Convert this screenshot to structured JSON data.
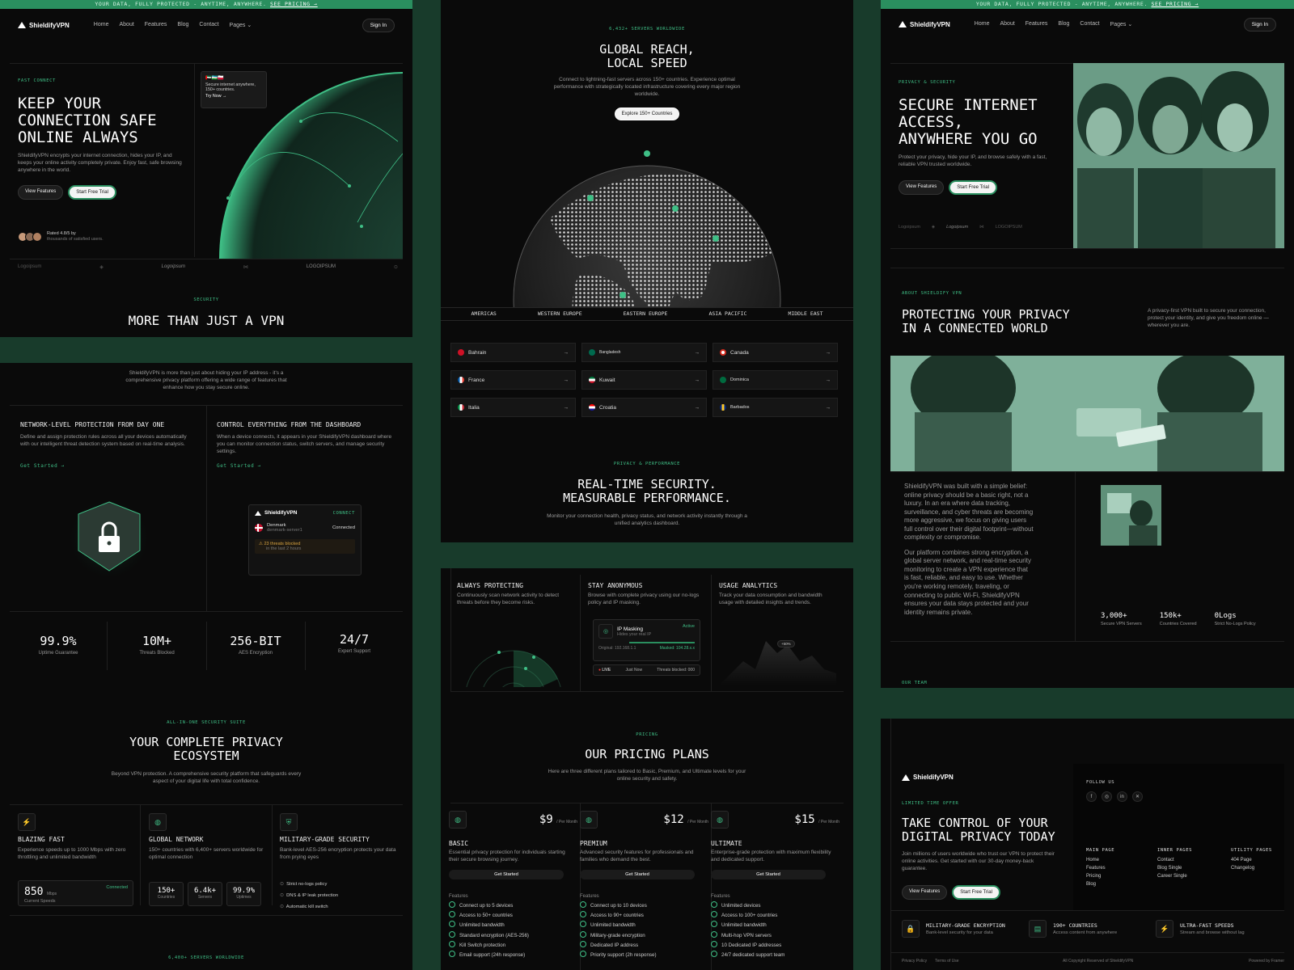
{
  "banner": {
    "text": "YOUR DATA, FULLY PROTECTED - ANYTIME, ANYWHERE.",
    "link": "SEE PRICING →"
  },
  "nav": {
    "logo": "ShieldifyVPN",
    "links": [
      "Home",
      "About",
      "Features",
      "Blog",
      "Contact",
      "Pages ⌄"
    ],
    "signin": "Sign In"
  },
  "hero": {
    "tag": "FAST CONNECT",
    "title_lines": [
      "KEEP YOUR",
      "CONNECTION SAFE",
      "ONLINE ALWAYS"
    ],
    "desc": "ShieldifyVPN encrypts your internet connection, hides your IP, and keeps your online activity completely private. Enjoy fast, safe browsing anywhere in the world.",
    "btn_features": "View Features",
    "btn_trial": "Start Free Trial",
    "popup_text": "Secure internet anywhere, 150+ countries.",
    "popup_link": "Try Now →",
    "rating_title": "Rated 4.8/5 by",
    "rating_sub": "thousands of satisfied users.",
    "logos": [
      "Logoipsum",
      "◈",
      "Logoipsum",
      "⋈",
      "LOGOIPSUM",
      "⊙"
    ]
  },
  "vpn_section": {
    "tag": "SECURITY",
    "title": "MORE THAN JUST A VPN",
    "desc": "ShieldifyVPN is more than just about hiding your IP address - it's a comprehensive privacy platform offering a wide range of features that enhance how you stay secure online."
  },
  "features2": [
    {
      "title": "NETWORK-LEVEL PROTECTION FROM DAY ONE",
      "desc": "Define and assign protection rules across all your devices automatically with our intelligent threat detection system based on real-time analysis.",
      "link": "Get Started →"
    },
    {
      "title": "CONTROL EVERYTHING FROM THE DASHBOARD",
      "desc": "When a device connects, it appears in your ShieldifyVPN dashboard where you can monitor connection status, switch servers, and manage security settings.",
      "link": "Get Started →"
    }
  ],
  "dash_card": {
    "logo": "ShieldifyVPN",
    "status": "CONNECT",
    "country": "Denmark",
    "server": "denmark-server1",
    "state": "Connected",
    "alert": "23 threats blocked",
    "alert_sub": "in the last 2 hours"
  },
  "stats": [
    {
      "num": "99.9%",
      "label": "Uptime Guarantee"
    },
    {
      "num": "10M+",
      "label": "Threats Blocked"
    },
    {
      "num": "256-BIT",
      "label": "AES Encryption"
    },
    {
      "num": "24/7",
      "label": "Expert Support"
    }
  ],
  "ecosystem": {
    "tag": "ALL-IN-ONE SECURITY SUITE",
    "title_lines": [
      "YOUR COMPLETE PRIVACY",
      "ECOSYSTEM"
    ],
    "desc": "Beyond VPN protection. A comprehensive security platform that safeguards every aspect of your digital life with total confidence.",
    "cols": [
      {
        "title": "BLAZING FAST",
        "desc": "Experience speeds up to 1000 Mbps with zero throttling and unlimited bandwidth"
      },
      {
        "title": "GLOBAL NETWORK",
        "desc": "150+ countries with 6,400+ servers worldwide for optimal connection"
      },
      {
        "title": "MILITARY-GRADE SECURITY",
        "desc": "Bank-level AES-256 encryption protects your data from prying eyes"
      }
    ],
    "speed": {
      "num": "850",
      "unit": "Mbps",
      "label": "Current Speeds",
      "status": "Connected"
    },
    "minis": [
      {
        "num": "150+",
        "label": "Countries"
      },
      {
        "num": "6.4k+",
        "label": "Servers"
      },
      {
        "num": "99.9%",
        "label": "Uptimes"
      }
    ],
    "checks": [
      "Strict no-logs policy",
      "DNS & IP leak protection",
      "Automatic kill switch"
    ],
    "bottom_tag": "6,400+ SERVERS WORLDWIDE"
  },
  "global": {
    "tag": "6,432+ SERVERS WORLDWIDE",
    "title_lines": [
      "GLOBAL REACH,",
      "LOCAL SPEED"
    ],
    "desc": "Connect to lightning-fast servers across 150+ countries. Experience optimal performance with strategically located infrastructure covering every major region worldwide.",
    "btn": "Explore 150+ Countries",
    "regions": [
      "AMERICAS",
      "WESTERN EUROPE",
      "EASTERN EUROPE",
      "ASIA PACIFIC",
      "MIDDLE EAST"
    ],
    "countries": [
      "Bahrain",
      "Bangladesh",
      "Canada",
      "France",
      "Kuwait",
      "Dominica",
      "Italia",
      "Croatia",
      "Barbados"
    ]
  },
  "realtime": {
    "tag": "PRIVACY & PERFORMANCE",
    "title_lines": [
      "REAL-TIME SECURITY.",
      "MEASURABLE PERFORMANCE."
    ],
    "desc": "Monitor your connection health, privacy status, and network activity instantly through a unified analytics dashboard.",
    "cols": [
      {
        "title": "ALWAYS PROTECTING",
        "desc": "Continuously scan network activity to detect threats before they become risks."
      },
      {
        "title": "STAY ANONYMOUS",
        "desc": "Browse with complete privacy using our no-logs policy and IP masking."
      },
      {
        "title": "USAGE ANALYTICS",
        "desc": "Track your data consumption and bandwidth usage with detailed insights and trends."
      }
    ],
    "mask": {
      "title": "IP Masking",
      "sub": "Hides your real IP",
      "badge": "Active",
      "original": "Original: 192.168.1.1",
      "masked": "Masked: 104.28.x.x",
      "live": "LIVE",
      "now": "Just Now",
      "threats": "Threats blocked: 000"
    },
    "chart_badge": "+50%"
  },
  "pricing": {
    "tag": "PRICING",
    "title": "OUR PRICING PLANS",
    "desc": "Here are three different plans tailored to Basic, Premium, and Ultimate levels for your online security and safety.",
    "per": "/ Per Month",
    "cta": "Get Started",
    "features_label": "Features",
    "plans": [
      {
        "price": "$9",
        "name": "BASIC",
        "desc": "Essential privacy protection for individuals starting their secure browsing journey.",
        "features": [
          "Connect up to 5 devices",
          "Access to 50+ countries",
          "Unlimited bandwidth",
          "Standard encryption (AES-256)",
          "Kill Switch protection",
          "Email support (24h response)"
        ]
      },
      {
        "price": "$12",
        "name": "PREMIUM",
        "desc": "Advanced security features for professionals and families who demand the best.",
        "features": [
          "Connect up to 10 devices",
          "Access to 90+ countries",
          "Unlimited bandwidth",
          "Military-grade encryption",
          "Dedicated IP address",
          "Priority support (2h response)"
        ]
      },
      {
        "price": "$15",
        "name": "ULTIMATE",
        "desc": "Enterprise-grade protection with maximum flexibility and dedicated support.",
        "features": [
          "Unlimited devices",
          "Access to 100+ countries",
          "Unlimited bandwidth",
          "Multi-hop VPN servers",
          "10 Dedicated IP addresses",
          "24/7 dedicated support team"
        ]
      }
    ]
  },
  "about": {
    "tag": "PRIVACY & SECURITY",
    "title_lines": [
      "SECURE INTERNET",
      "ACCESS,",
      "ANYWHERE YOU GO"
    ],
    "desc": "Protect your privacy, hide your IP, and browse safely with a fast, reliable VPN trusted worldwide.",
    "tag2": "ABOUT SHIELDIFY VPN",
    "title2_lines": [
      "PROTECTING YOUR PRIVACY",
      "IN A CONNECTED WORLD"
    ],
    "desc2": "A privacy-first VPN built to secure your connection, protect your identity, and give you freedom online —wherever you are.",
    "body1": "ShieldifyVPN was built with a simple belief: online privacy should be a basic right, not a luxury. In an era where data tracking, surveillance, and cyber threats are becoming more aggressive, we focus on giving users full control over their digital footprint—without complexity or compromise.",
    "body2": "Our platform combines strong encryption, a global server network, and real-time security monitoring to create a VPN experience that is fast, reliable, and easy to use. Whether you're working remotely, traveling, or connecting to public Wi-Fi, ShieldifyVPN ensures your data stays protected and your identity remains private.",
    "stats": [
      {
        "num": "3,000+",
        "label": "Secure VPN Servers"
      },
      {
        "num": "150k+",
        "label": "Countries Covered"
      },
      {
        "num": "0Logs",
        "label": "Strict No-Logs Policy"
      }
    ],
    "team_tag": "OUR TEAM"
  },
  "footer": {
    "tag": "LIMITED TIME OFFER",
    "title_lines": [
      "TAKE CONTROL OF YOUR",
      "DIGITAL PRIVACY TODAY"
    ],
    "desc": "Join millions of users worldwide who trust our VPN to protect their online activities. Get started with our 30-day money-back guarantee.",
    "follow": "FOLLOW US",
    "cols": [
      {
        "title": "MAIN PAGE",
        "items": [
          "Home",
          "Features",
          "Pricing",
          "Blog"
        ]
      },
      {
        "title": "INNER PAGES",
        "items": [
          "Contact",
          "Blog Single",
          "Career Single"
        ]
      },
      {
        "title": "UTILITY PAGES",
        "items": [
          "404 Page",
          "Changelog"
        ]
      }
    ],
    "badges": [
      {
        "title": "MILITARY-GRADE ENCRYPTION",
        "desc": "Bank-level security for your data"
      },
      {
        "title": "190+ COUNTRIES",
        "desc": "Access content from anywhere"
      },
      {
        "title": "ULTRA-FAST SPEEDS",
        "desc": "Stream and browse without lag"
      }
    ],
    "legal": [
      "Privacy Policy",
      "Terms of Use"
    ],
    "copyright": "All Copyright Reserved of ShieldifyVPN",
    "powered": "Powered by Framer"
  },
  "colors": {
    "accent": "#3fbf86",
    "banner": "#2a8f5f",
    "bg": "#0a0a0a",
    "outer": "#183b2b"
  }
}
